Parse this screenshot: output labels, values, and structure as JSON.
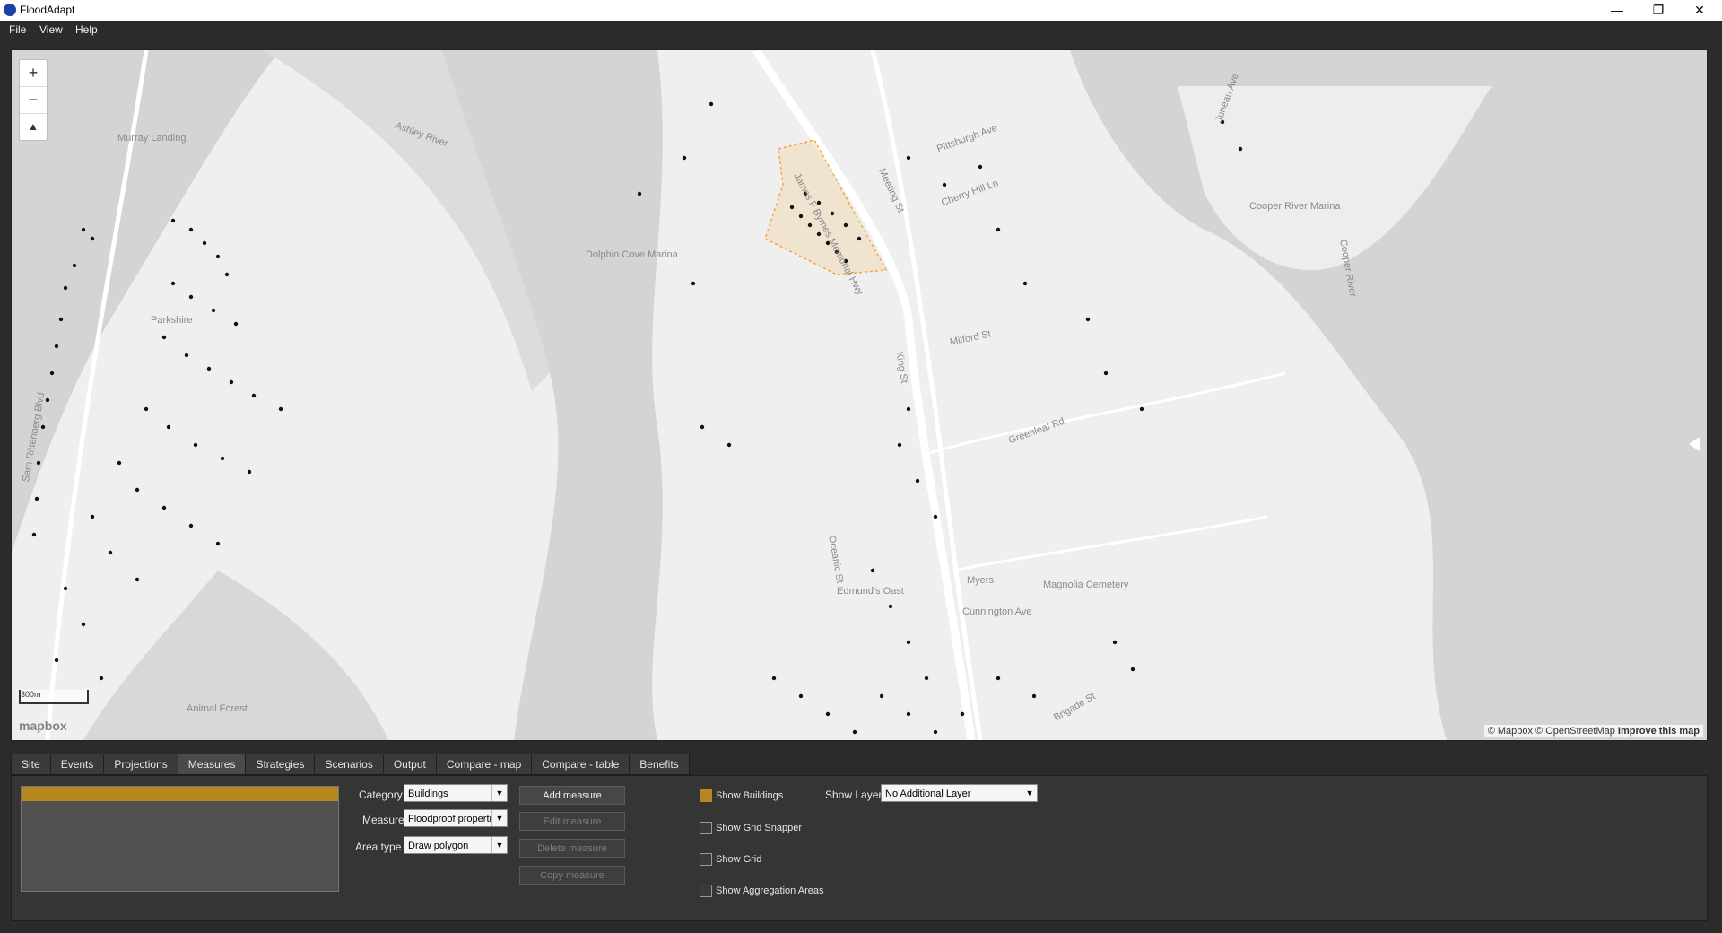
{
  "window": {
    "title": "FloodAdapt",
    "minimize": "—",
    "maximize": "❐",
    "close": "✕"
  },
  "menu": [
    "File",
    "View",
    "Help"
  ],
  "map": {
    "zoom_in": "+",
    "zoom_out": "−",
    "compass": "▲",
    "scale_label": "300m",
    "logo": "mapbox",
    "attribution": "© Mapbox © OpenStreetMap",
    "improve": "Improve this map",
    "labels": [
      "Murray Landing",
      "Ashley River",
      "Parkshire",
      "Dolphin Cove Marina",
      "James F Byrnes Memorial Hwy",
      "Meeting St",
      "King St",
      "Milford St",
      "Greenleaf Rd",
      "Myers",
      "Magnolia Cemetery",
      "Cunnington Ave",
      "Brigade St",
      "Cooper River",
      "Cooper River Marina",
      "Juneau Ave",
      "Animal Forest",
      "Oceanic St",
      "Sam Rittenberg Blvd",
      "Edmund's Oast",
      "Cherry Hill Ln",
      "Pittsburgh Ave"
    ]
  },
  "tabs": [
    "Site",
    "Events",
    "Projections",
    "Measures",
    "Strategies",
    "Scenarios",
    "Output",
    "Compare - map",
    "Compare - table",
    "Benefits"
  ],
  "active_tab": "Measures",
  "measures": {
    "category_label": "Category",
    "category_value": "Buildings",
    "measure_label": "Measure",
    "measure_value": "Floodproof properti",
    "area_label": "Area type",
    "area_value": "Draw polygon",
    "add": "Add measure",
    "edit": "Edit measure",
    "delete": "Delete measure",
    "copy": "Copy measure",
    "show_buildings": "Show Buildings",
    "show_grid_snapper": "Show Grid Snapper",
    "show_grid": "Show Grid",
    "show_aggregation": "Show Aggregation Areas",
    "show_layer_label": "Show Layer",
    "show_layer_value": "No Additional Layer"
  },
  "colors": {
    "accent": "#b8861e",
    "building_dot": "#111111",
    "water": "#d4d4d4",
    "land": "#efefef",
    "polygon": "#f3b24a"
  }
}
